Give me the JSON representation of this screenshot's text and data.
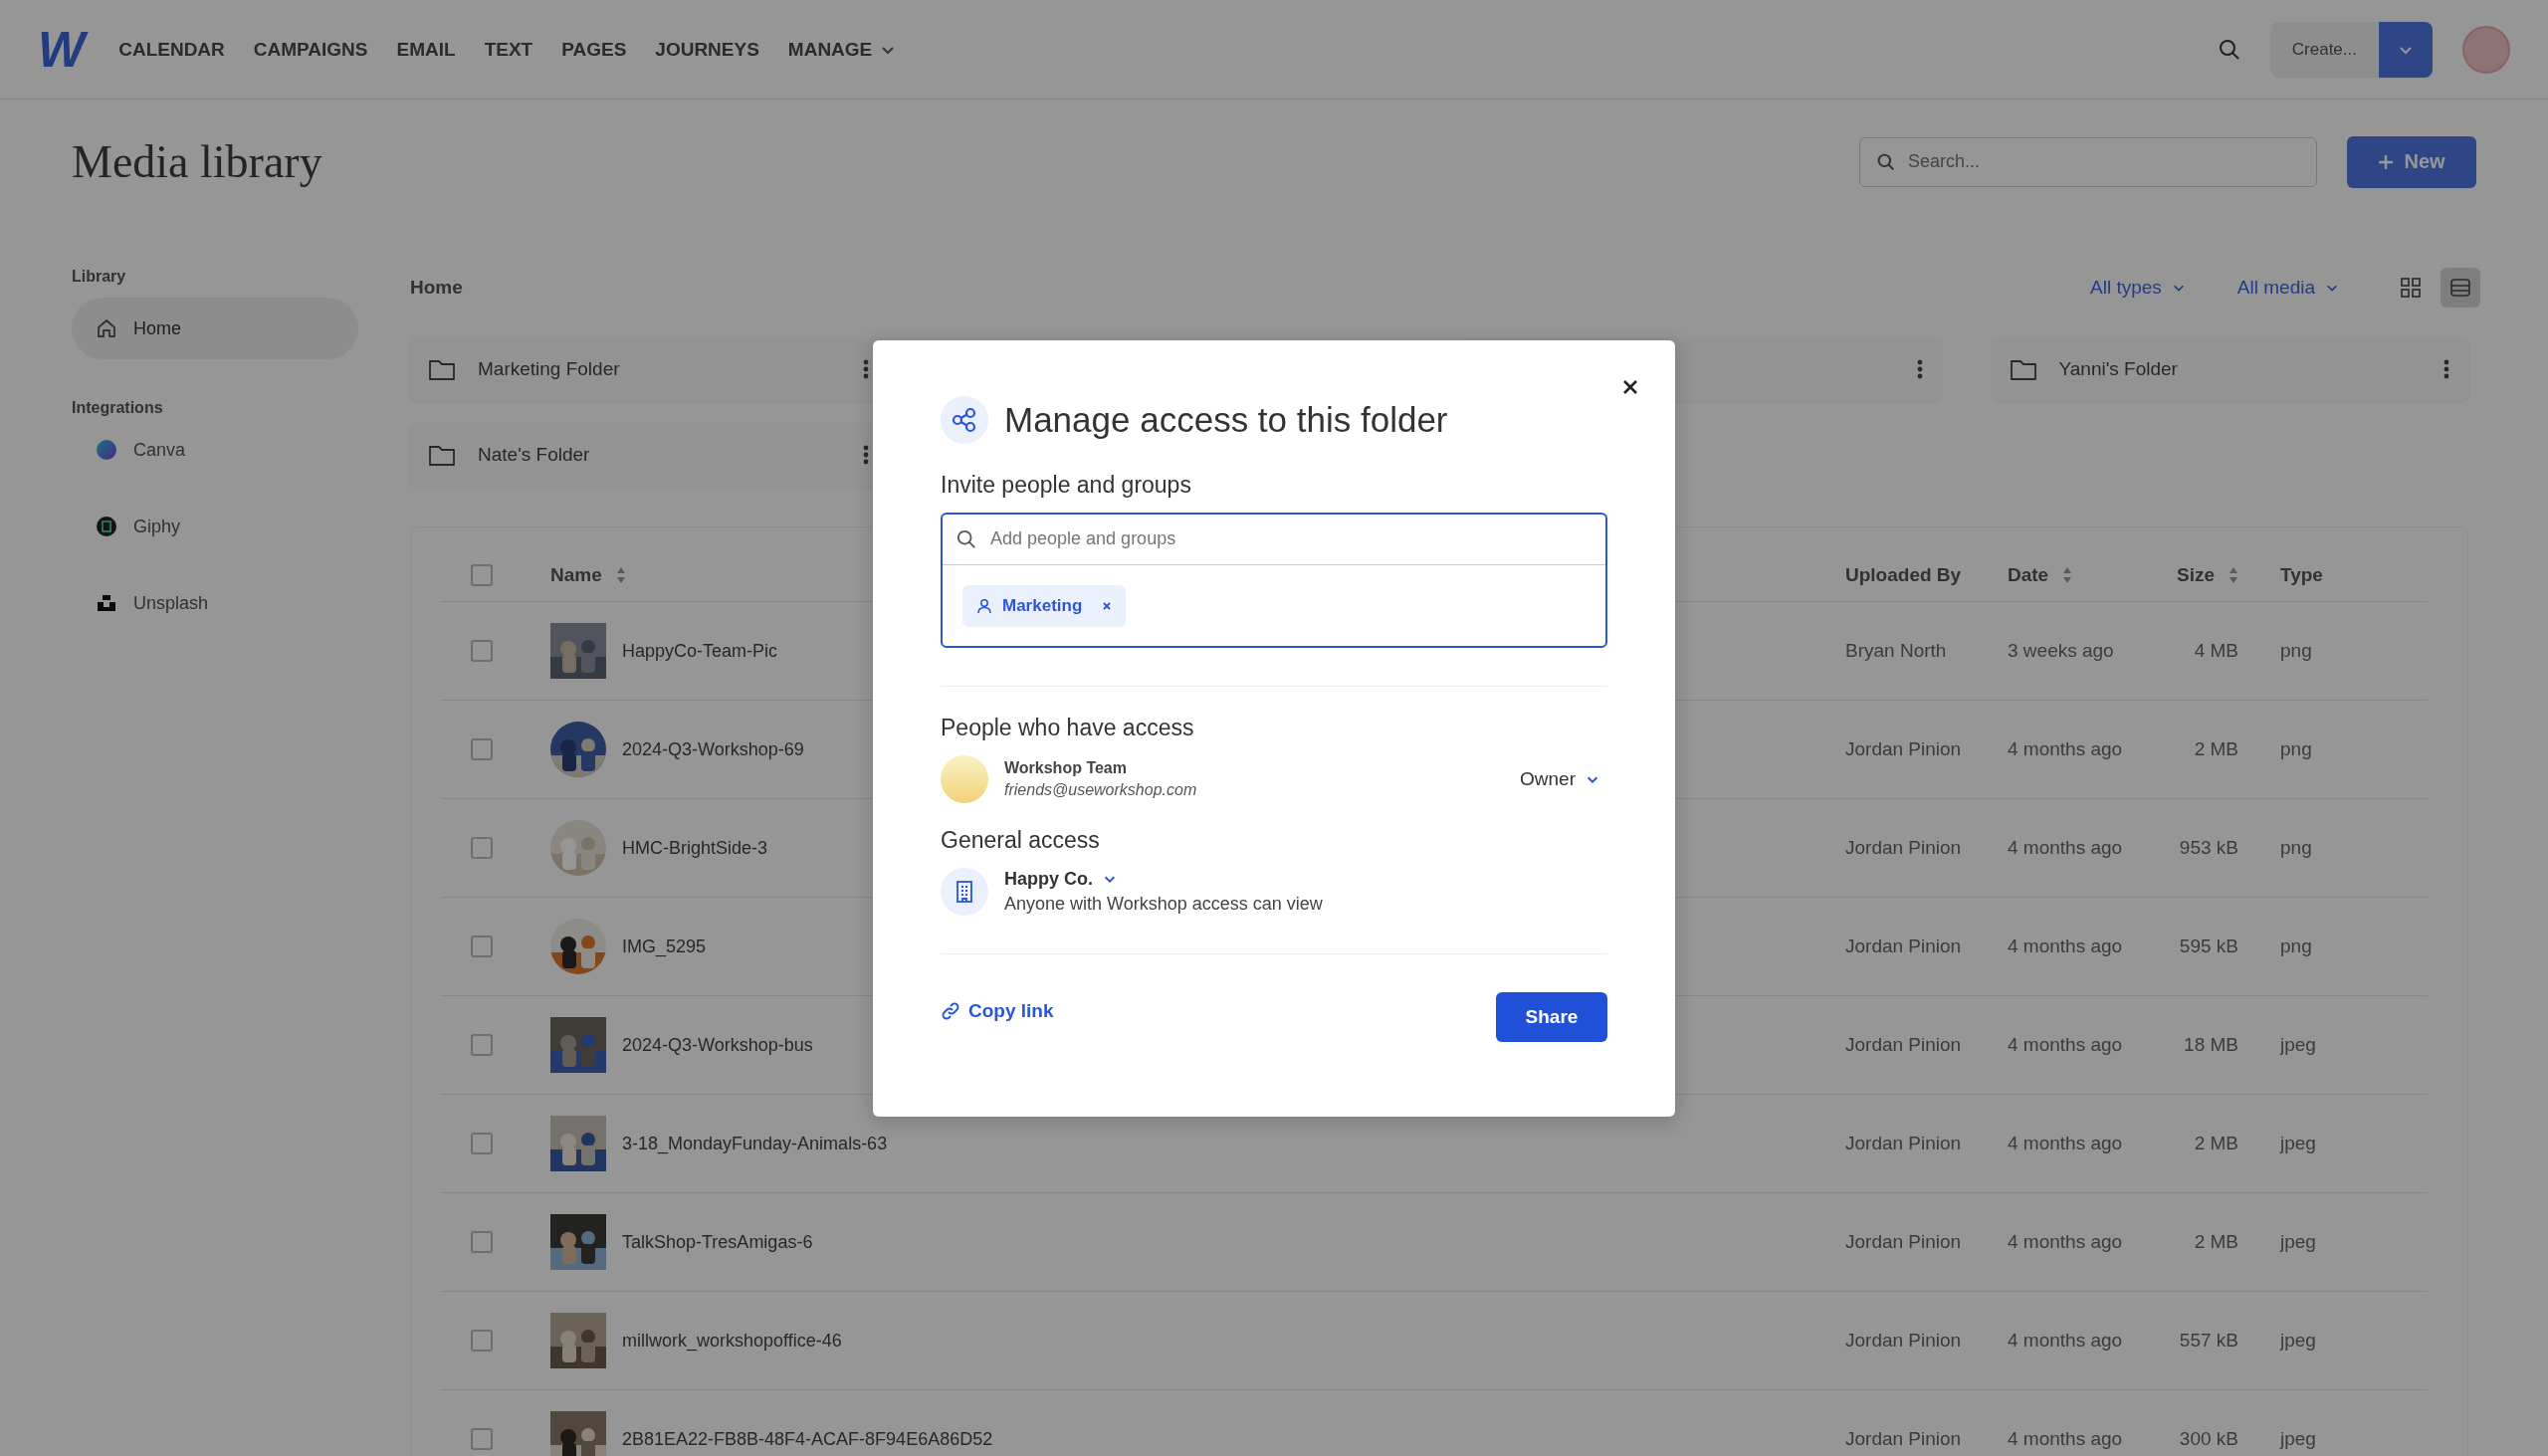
{
  "nav": {
    "logo": "W",
    "items": [
      {
        "label": "CALENDAR",
        "kind": "link"
      },
      {
        "label": "CAMPAIGNS",
        "kind": "link"
      },
      {
        "label": "EMAIL",
        "kind": "link"
      },
      {
        "label": "TEXT",
        "kind": "link"
      },
      {
        "label": "PAGES",
        "kind": "link"
      },
      {
        "label": "JOURNEYS",
        "kind": "link"
      },
      {
        "label": "MANAGE",
        "kind": "menu"
      }
    ],
    "create_button": "Create..."
  },
  "page": {
    "title": "Media library",
    "search_placeholder": "Search...",
    "new_button": "New"
  },
  "sidebar": {
    "sections": [
      {
        "heading": "Library",
        "items": [
          {
            "label": "Home",
            "selected": true
          }
        ]
      },
      {
        "heading": "Integrations",
        "items": [
          {
            "label": "Canva",
            "selected": false
          },
          {
            "label": "Giphy",
            "selected": false
          },
          {
            "label": "Unsplash",
            "selected": false
          }
        ]
      }
    ]
  },
  "breadcrumb": "Home",
  "filters": [
    {
      "label": "All types"
    },
    {
      "label": "All media"
    }
  ],
  "views": [
    {
      "kind": "grid",
      "selected": false
    },
    {
      "kind": "list",
      "selected": true
    }
  ],
  "folders": [
    {
      "kind": "folder",
      "name": "Marketing Folder"
    },
    {
      "kind": "covered"
    },
    {
      "kind": "folder",
      "name": "Yanni's Folder"
    },
    {
      "kind": "folder",
      "name": "Nate's Folder"
    }
  ],
  "table": {
    "select_all_checked": false,
    "columns": [
      {
        "label": "Name",
        "sortable": true
      },
      {
        "label": "Uploaded By",
        "sortable": false
      },
      {
        "label": "Date",
        "sortable": true
      },
      {
        "label": "Size",
        "sortable": true
      },
      {
        "label": "Type",
        "sortable": false
      }
    ],
    "rows": [
      {
        "name": "HappyCo-Team-Pic",
        "uploaded_by": "Bryan North",
        "date": "3 weeks ago",
        "size": "4 MB",
        "type": "png",
        "checked": false,
        "round_thumbnail": false
      },
      {
        "name": "2024-Q3-Workshop-69",
        "uploaded_by": "Jordan Pinion",
        "date": "4 months ago",
        "size": "2 MB",
        "type": "png",
        "checked": false,
        "round_thumbnail": true
      },
      {
        "name": "HMC-BrightSide-3",
        "uploaded_by": "Jordan Pinion",
        "date": "4 months ago",
        "size": "953 kB",
        "type": "png",
        "checked": false,
        "round_thumbnail": true
      },
      {
        "name": "IMG_5295",
        "uploaded_by": "Jordan Pinion",
        "date": "4 months ago",
        "size": "595 kB",
        "type": "png",
        "checked": false,
        "round_thumbnail": true
      },
      {
        "name": "2024-Q3-Workshop-bus",
        "uploaded_by": "Jordan Pinion",
        "date": "4 months ago",
        "size": "18 MB",
        "type": "jpeg",
        "checked": false,
        "round_thumbnail": false
      },
      {
        "name": "3-18_MondayFunday-Animals-63",
        "uploaded_by": "Jordan Pinion",
        "date": "4 months ago",
        "size": "2 MB",
        "type": "jpeg",
        "checked": false,
        "round_thumbnail": false
      },
      {
        "name": "TalkShop-TresAmigas-6",
        "uploaded_by": "Jordan Pinion",
        "date": "4 months ago",
        "size": "2 MB",
        "type": "jpeg",
        "checked": false,
        "round_thumbnail": false
      },
      {
        "name": "millwork_workshopoffice-46",
        "uploaded_by": "Jordan Pinion",
        "date": "4 months ago",
        "size": "557 kB",
        "type": "jpeg",
        "checked": false,
        "round_thumbnail": false
      },
      {
        "name": "2B81EA22-FB8B-48F4-ACAF-8F94E6A86D52",
        "uploaded_by": "Jordan Pinion",
        "date": "4 months ago",
        "size": "300 kB",
        "type": "jpeg",
        "checked": false,
        "round_thumbnail": false
      }
    ]
  },
  "modal": {
    "title": "Manage access to this folder",
    "invite_heading": "Invite people and groups",
    "invite_placeholder": "Add people and groups",
    "chips": [
      {
        "label": "Marketing"
      }
    ],
    "access_heading": "People who have access",
    "people": [
      {
        "name": "Workshop Team",
        "email": "friends@useworkshop.com",
        "role": "Owner"
      }
    ],
    "general_heading": "General access",
    "general": {
      "organization": "Happy Co.",
      "description": "Anyone with Workshop access can view"
    },
    "copy_link": "Copy link",
    "share_button": "Share"
  }
}
